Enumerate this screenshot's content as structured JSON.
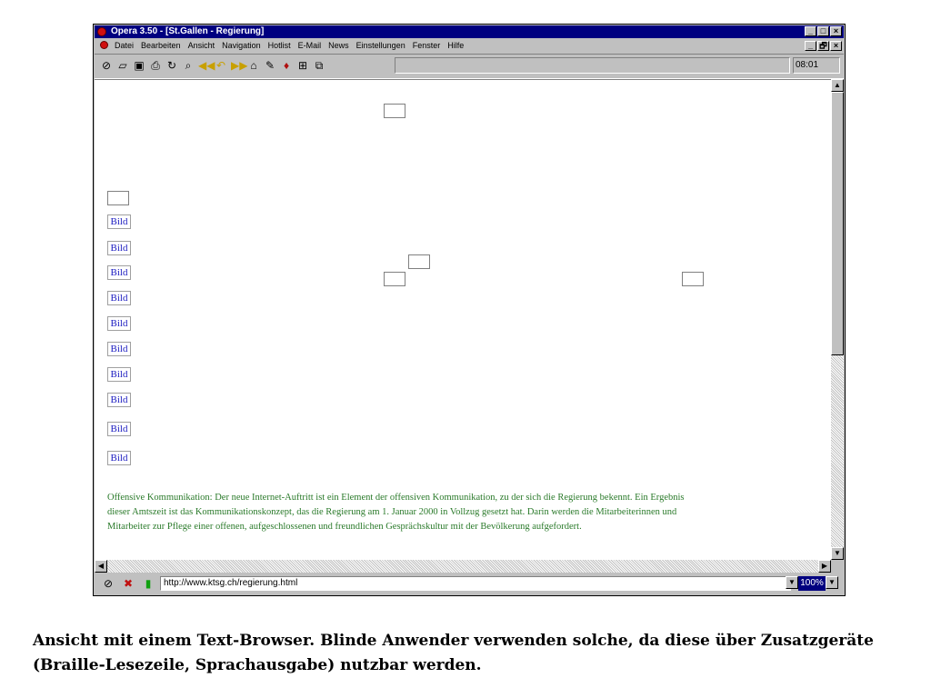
{
  "window": {
    "title": "Opera 3.50 - [St.Gallen - Regierung]",
    "caption_buttons": [
      "_",
      "□",
      "×"
    ],
    "mdi_buttons": [
      "_",
      "🗗",
      "×"
    ]
  },
  "menu": [
    "Datei",
    "Bearbeiten",
    "Ansicht",
    "Navigation",
    "Hotlist",
    "E-Mail",
    "News",
    "Einstellungen",
    "Fenster",
    "Hilfe"
  ],
  "toolbar": {
    "icons": [
      "open-icon",
      "folder-icon",
      "save-icon",
      "print-icon",
      "reload-icon",
      "find-icon",
      "back-fast-icon",
      "back-icon",
      "forward-icon",
      "home-icon",
      "hotlist-icon",
      "mail-icon",
      "tile-icon",
      "cascade-icon"
    ],
    "clock": "08:01"
  },
  "content": {
    "image_placeholder": "Bild",
    "bild_count": 10,
    "paragraph": "Offensive Kommunikation: Der neue Internet-Auftritt ist ein Element der offensiven Kommunikation, zu der sich die Regierung bekennt. Ein Ergebnis dieser Amtszeit ist das Kommunikationskonzept, das die Regierung am 1. Januar 2000 in Vollzug gesetzt hat. Darin werden die Mitarbeiterinnen und Mitarbeiter zur Pflege einer offenen, aufgeschlossenen und freundlichen Gesprächskultur mit der Bevölkerung aufgefordert."
  },
  "status": {
    "url": "http://www.ktsg.ch/regierung.html",
    "zoom": "100%"
  },
  "caption": "Ansicht mit einem Text-Browser. Blinde Anwender verwenden solche, da diese über Zusatzgeräte (Braille-Lesezeile, Sprachausgabe) nutzbar werden."
}
